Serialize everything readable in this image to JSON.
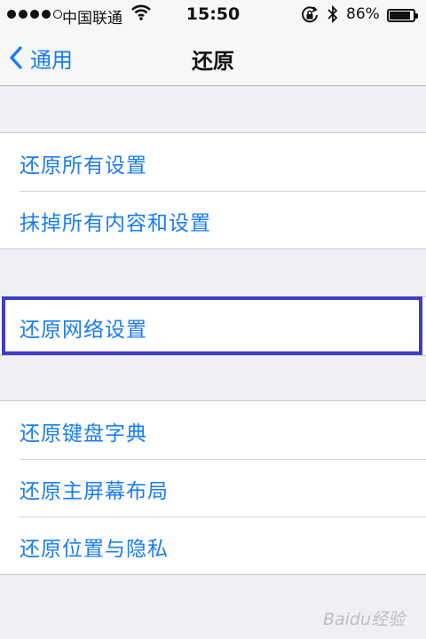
{
  "status_bar": {
    "carrier": "中国联通",
    "time": "15:50",
    "battery": "86%",
    "battery_level": 0.86,
    "icons": [
      "signal-dots-icon",
      "wifi-icon",
      "rotation-lock-icon",
      "bluetooth-icon",
      "battery-icon"
    ]
  },
  "nav": {
    "back_label": "通用",
    "title": "还原"
  },
  "groups": [
    {
      "items": [
        {
          "label": "还原所有设置"
        },
        {
          "label": "抹掉所有内容和设置"
        }
      ]
    },
    {
      "items": [
        {
          "label": "还原网络设置"
        }
      ],
      "highlighted": true
    },
    {
      "items": [
        {
          "label": "还原键盘字典"
        },
        {
          "label": "还原主屏幕布局"
        },
        {
          "label": "还原位置与隐私"
        }
      ]
    }
  ],
  "colors": {
    "accent": "#1a7cf5",
    "highlight_border": "#3d3dc5",
    "background": "#efeff4"
  },
  "watermark": "Baidu经验"
}
